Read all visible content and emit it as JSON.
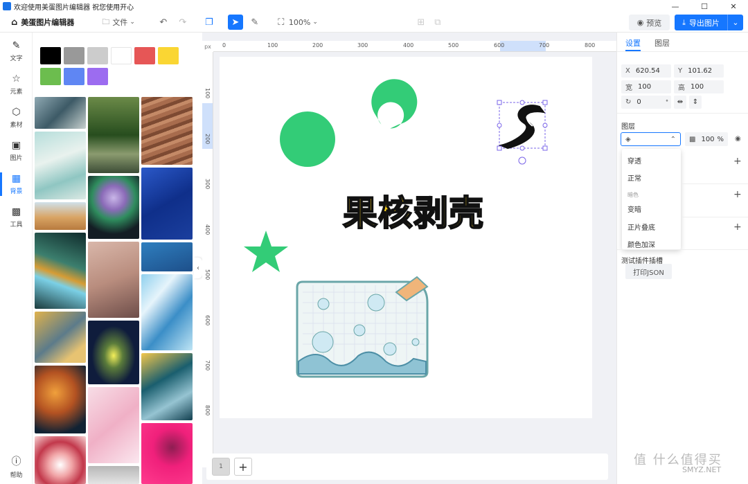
{
  "titlebar": {
    "title": "欢迎使用美蛋图片编辑器 祝您使用开心",
    "minimize": "—",
    "maximize": "☐",
    "close": "✕"
  },
  "toolbar": {
    "app_name": "美蛋图片编辑器",
    "file_label": "文件",
    "zoom_label": "100%",
    "preview_label": "预览",
    "export_label": "导出图片"
  },
  "nav": {
    "items": [
      {
        "label": "文字",
        "icon": "pen-icon"
      },
      {
        "label": "元素",
        "icon": "star-icon"
      },
      {
        "label": "素材",
        "icon": "cube-icon"
      },
      {
        "label": "图片",
        "icon": "image-icon"
      },
      {
        "label": "背景",
        "icon": "checker-icon"
      },
      {
        "label": "工具",
        "icon": "qr-icon"
      },
      {
        "label": "帮助",
        "icon": "help-icon"
      }
    ]
  },
  "colors": {
    "swatches": [
      "#000000",
      "#999999",
      "#cccccc",
      "#ffffff",
      "#e65656",
      "#fad633",
      "#6cbd4e",
      "#5f86f3",
      "#9c6cf0"
    ],
    "accent": "#1677ff"
  },
  "ruler": {
    "unit": "px",
    "h_labels": [
      "0",
      "100",
      "200",
      "300",
      "400",
      "500",
      "600",
      "700",
      "800"
    ],
    "v_labels": [
      "100",
      "200",
      "300",
      "400",
      "500",
      "600",
      "700",
      "800"
    ]
  },
  "canvas": {
    "title_text": "果核剥壳"
  },
  "pages": {
    "current": "1",
    "add": "+"
  },
  "right": {
    "tabs": [
      "设置",
      "图层"
    ],
    "x_label": "X",
    "x_value": "620.54",
    "y_label": "Y",
    "y_value": "101.62",
    "w_label": "宽",
    "w_value": "100",
    "h_label": "高",
    "h_value": "100",
    "rotation_value": "0",
    "rotation_unit": "°",
    "layer_title": "图层",
    "opacity_value": "100",
    "opacity_unit": "%",
    "blend_options": [
      "穿透",
      "正常"
    ],
    "blend_group": "暗色",
    "blend_options2": [
      "变暗",
      "正片叠底",
      "颜色加深"
    ],
    "plugin_title": "测试插件插槽",
    "print_json": "打印JSON"
  },
  "watermark": {
    "text": "值 什么值得买",
    "site": "SMYZ.NET"
  }
}
